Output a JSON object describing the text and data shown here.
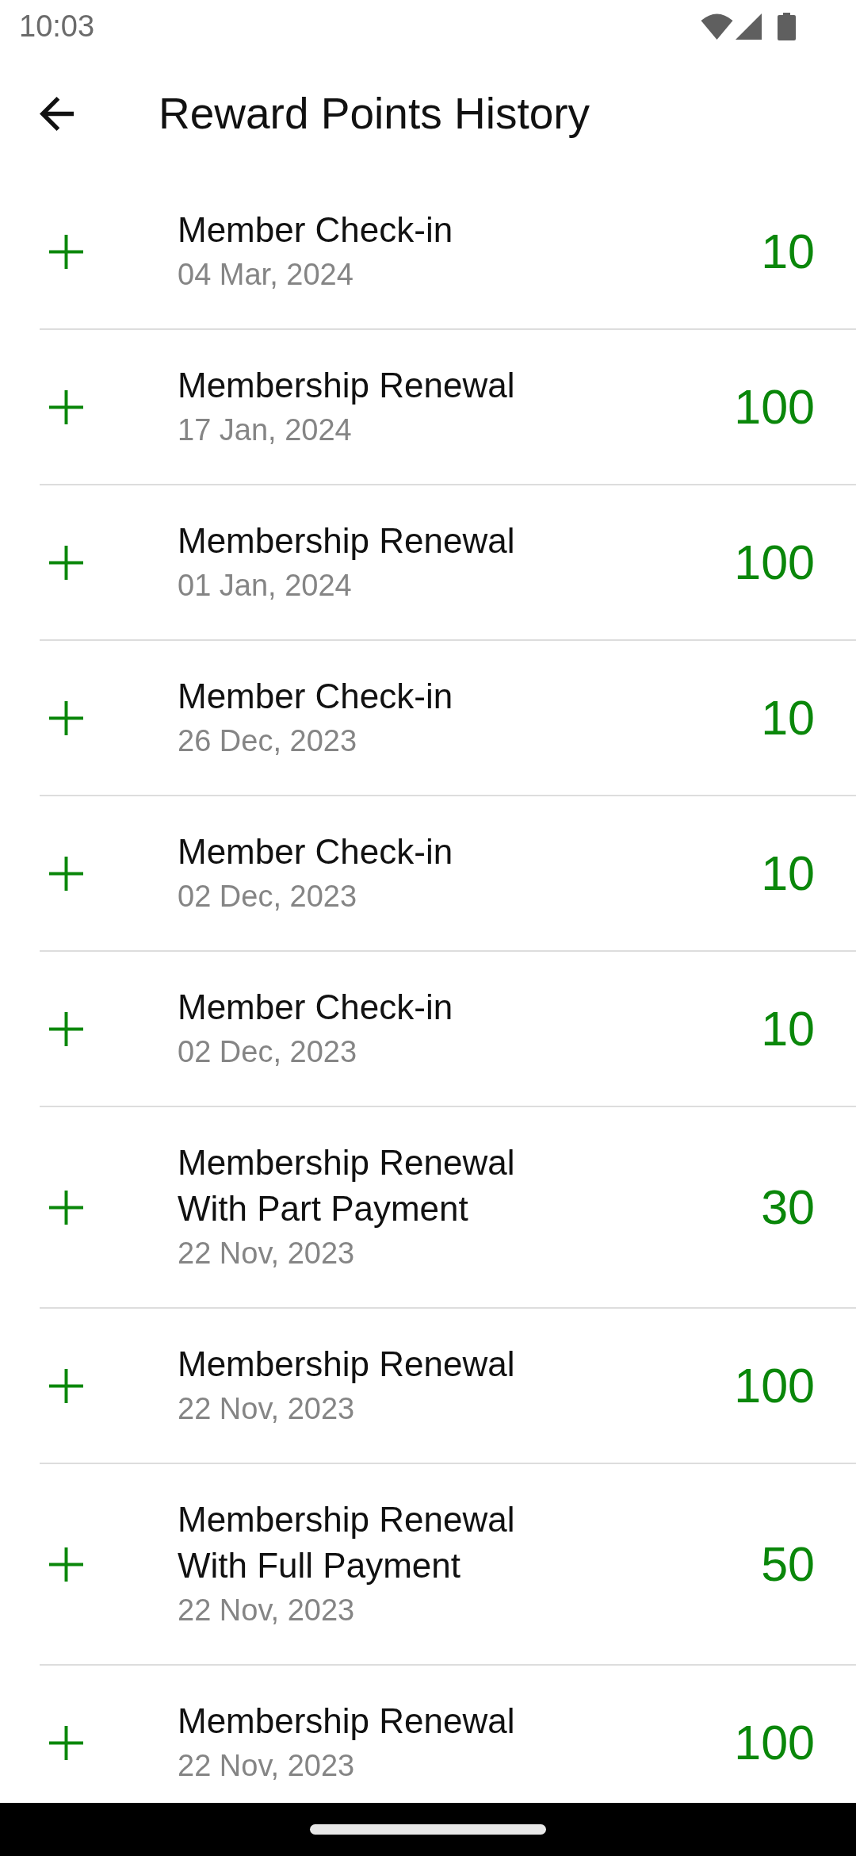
{
  "status_bar": {
    "time": "10:03"
  },
  "app_bar": {
    "title": "Reward Points History"
  },
  "history": [
    {
      "title": "Member Check-in",
      "date": "04 Mar, 2024",
      "points": "10"
    },
    {
      "title": "Membership Renewal",
      "date": "17 Jan, 2024",
      "points": "100"
    },
    {
      "title": "Membership Renewal",
      "date": "01 Jan, 2024",
      "points": "100"
    },
    {
      "title": "Member Check-in",
      "date": "26 Dec, 2023",
      "points": "10"
    },
    {
      "title": "Member Check-in",
      "date": "02 Dec, 2023",
      "points": "10"
    },
    {
      "title": "Member Check-in",
      "date": "02 Dec, 2023",
      "points": "10"
    },
    {
      "title": "Membership Renewal With Part Payment",
      "date": "22 Nov, 2023",
      "points": "30"
    },
    {
      "title": "Membership Renewal",
      "date": "22 Nov, 2023",
      "points": "100"
    },
    {
      "title": "Membership Renewal With Full Payment",
      "date": "22 Nov, 2023",
      "points": "50"
    },
    {
      "title": "Membership Renewal",
      "date": "22 Nov, 2023",
      "points": "100"
    }
  ]
}
